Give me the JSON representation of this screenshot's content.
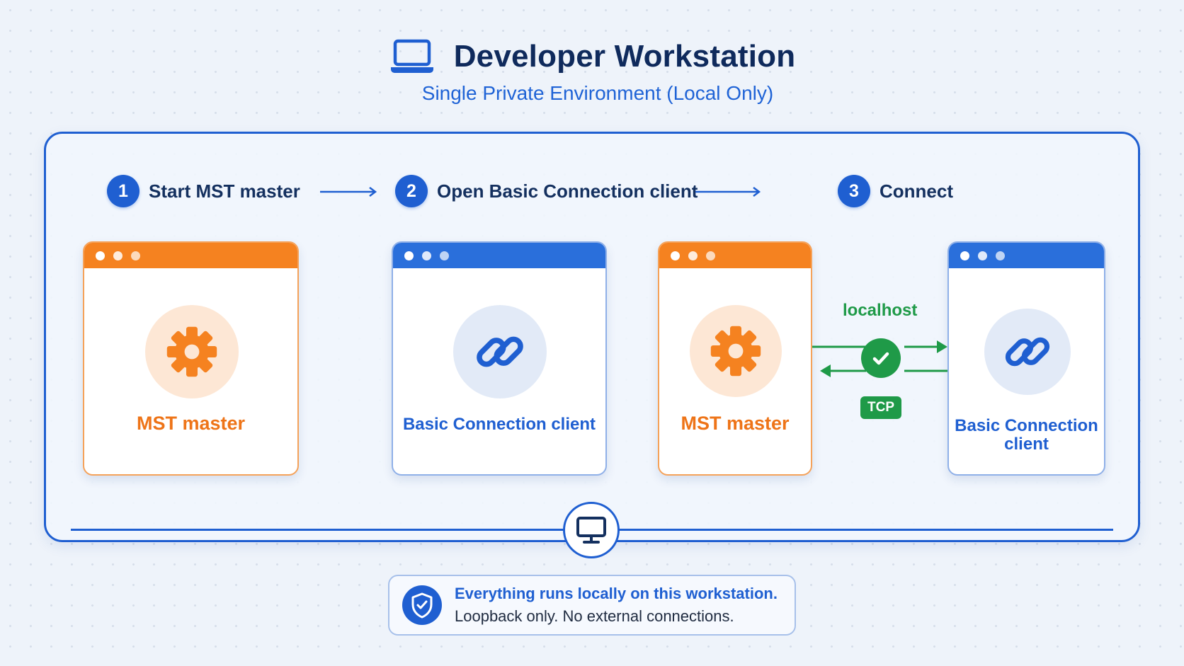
{
  "header": {
    "title": "Developer Workstation",
    "subtitle": "Single Private Environment (Local Only)",
    "icon": "laptop-icon"
  },
  "steps": [
    {
      "number": "1",
      "label": "Start MST master"
    },
    {
      "number": "2",
      "label": "Open Basic Connection client"
    },
    {
      "number": "3",
      "label": "Connect"
    }
  ],
  "cards": {
    "mst_master_1": {
      "label": "MST master",
      "icon": "gear-icon",
      "accent": "#f58220"
    },
    "basic_client_1": {
      "label": "Basic Connection client",
      "icon": "link-icon",
      "accent": "#2a6fdb"
    },
    "mst_master_2": {
      "label": "MST master",
      "icon": "gear-icon",
      "accent": "#f58220"
    },
    "basic_client_2": {
      "label_line1": "Basic Connection",
      "label_line2": "client",
      "icon": "link-icon",
      "accent": "#2a6fdb"
    }
  },
  "connection": {
    "host_label": "localhost",
    "protocol": "TCP",
    "status_icon": "check-icon",
    "color": "#1f9a48"
  },
  "footer": {
    "icon": "monitor-icon",
    "info_icon": "shield-check-icon",
    "info_line1": "Everything runs locally on this workstation.",
    "info_line2": "Loopback only. No external connections."
  },
  "colors": {
    "primary": "#1f5fd1",
    "orange": "#f58220",
    "green": "#1f9a48",
    "title": "#0f2a5c"
  }
}
